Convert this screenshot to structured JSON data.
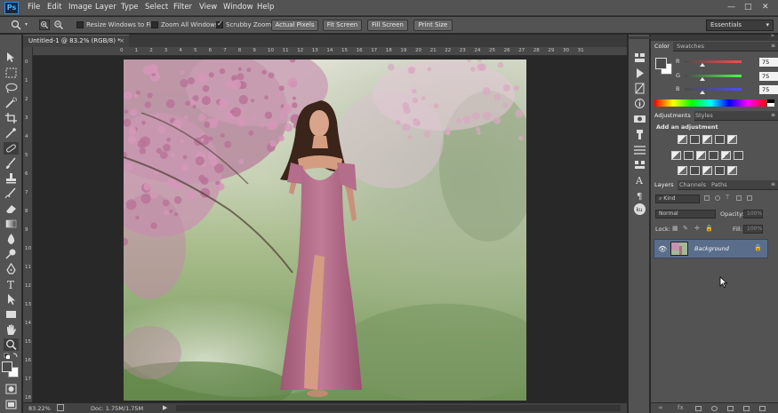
{
  "app": {
    "logo": "Ps"
  },
  "menu": [
    "File",
    "Edit",
    "Image",
    "Layer",
    "Type",
    "Select",
    "Filter",
    "View",
    "Window",
    "Help"
  ],
  "window_controls": [
    "—",
    "□",
    "✕"
  ],
  "options_bar": {
    "resize_windows_label": "Resize Windows to Fit",
    "resize_windows_checked": false,
    "zoom_all_label": "Zoom All Windows",
    "zoom_all_checked": false,
    "scrubby_zoom_label": "Scrubby Zoom",
    "scrubby_zoom_checked": true,
    "buttons": [
      "Actual Pixels",
      "Fit Screen",
      "Fill Screen",
      "Print Size"
    ],
    "workspace": "Essentials"
  },
  "document": {
    "tab_title": "Untitled-1 @ 83.2% (RGB/8) *",
    "close": "×",
    "ruler_top": [
      "0",
      "1",
      "2",
      "3",
      "4",
      "5",
      "6",
      "7",
      "8",
      "9",
      "10",
      "11",
      "12",
      "13",
      "14",
      "15",
      "16",
      "17",
      "18",
      "19",
      "20",
      "21",
      "22",
      "23",
      "24",
      "25",
      "26",
      "27",
      "28",
      "29",
      "30",
      "31"
    ],
    "ruler_left": [
      "0",
      "1",
      "2",
      "3",
      "4",
      "5",
      "6",
      "7",
      "8",
      "9",
      "10",
      "11",
      "12",
      "13",
      "14",
      "15",
      "16",
      "17",
      "18"
    ]
  },
  "status": {
    "zoom": "83.22%",
    "doc_info": "Doc: 1.75M/1.75M"
  },
  "color_panel": {
    "tabs": [
      "Color",
      "Swatches"
    ],
    "channels": [
      {
        "label": "R",
        "value": "75"
      },
      {
        "label": "G",
        "value": "75"
      },
      {
        "label": "B",
        "value": "75"
      }
    ],
    "foreground": "#4b4b4b",
    "background": "#ffffff"
  },
  "adjustments_panel": {
    "tabs": [
      "Adjustments",
      "Styles"
    ],
    "heading": "Add an adjustment"
  },
  "layers_panel": {
    "tabs": [
      "Layers",
      "Channels",
      "Paths"
    ],
    "kind_filter": "Kind",
    "blend_mode": "Normal",
    "opacity_label": "Opacity:",
    "opacity_value": "100%",
    "lock_label": "Lock:",
    "fill_label": "Fill:",
    "fill_value": "100%",
    "layers": [
      {
        "name": "Background",
        "visible": true,
        "locked": true
      }
    ]
  },
  "colors": {
    "menubar": "#535353",
    "canvas_bg": "#282828",
    "selected_layer": "#5a6e8c",
    "dress": "#b06b86",
    "blossom": "#c98bb0"
  }
}
